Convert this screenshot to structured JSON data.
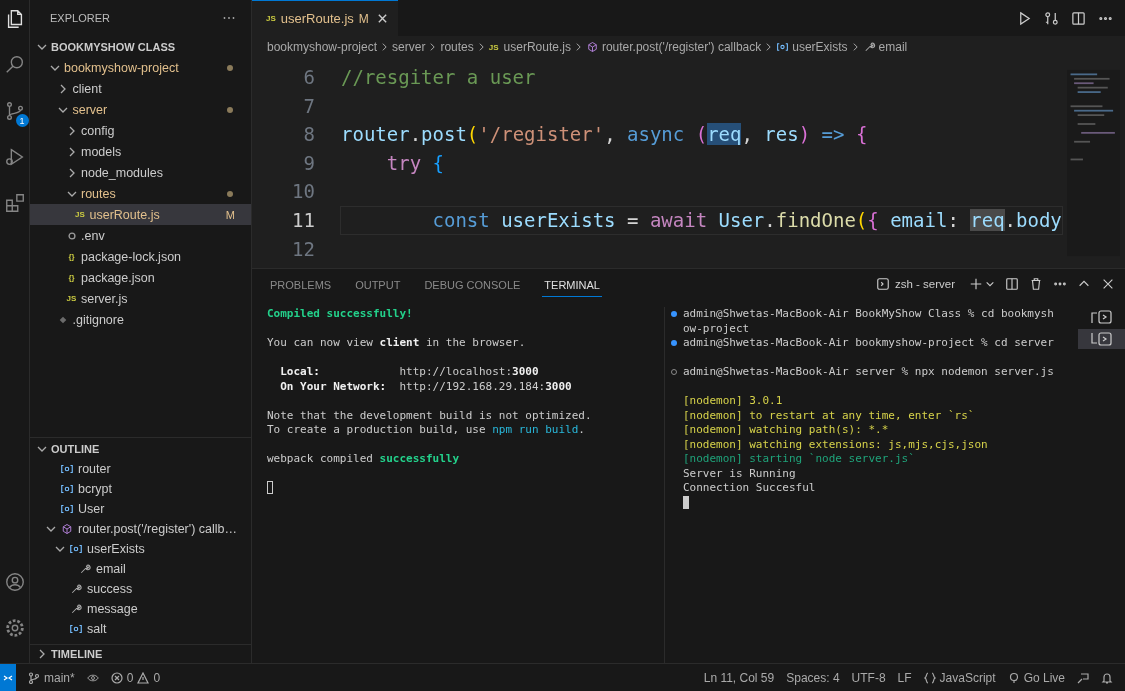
{
  "activity_bar": {
    "items": [
      {
        "kind": "files",
        "selected": true
      },
      {
        "kind": "search",
        "selected": false
      },
      {
        "kind": "source-control",
        "selected": false,
        "badge": "1"
      },
      {
        "kind": "run",
        "selected": false
      },
      {
        "kind": "extensions",
        "selected": false
      }
    ],
    "bottom": [
      {
        "kind": "account"
      },
      {
        "kind": "settings"
      }
    ]
  },
  "explorer": {
    "title": "EXPLORER",
    "workspace": {
      "label": "BOOKMYSHOW CLASS",
      "expanded": true
    },
    "tree": [
      {
        "name": "bookmyshow-project",
        "kind": "folder",
        "expanded": true,
        "modified": true,
        "selected": false,
        "children": [
          {
            "name": "client",
            "kind": "folder",
            "expanded": false,
            "modified": false,
            "selected": false
          },
          {
            "name": "server",
            "kind": "folder",
            "expanded": true,
            "modified": true,
            "selected": false,
            "children": [
              {
                "name": "config",
                "kind": "folder",
                "expanded": false,
                "modified": false,
                "selected": false
              },
              {
                "name": "models",
                "kind": "folder",
                "expanded": false,
                "modified": false,
                "selected": false
              },
              {
                "name": "node_modules",
                "kind": "folder",
                "expanded": false,
                "modified": false,
                "selected": false
              },
              {
                "name": "routes",
                "kind": "folder",
                "expanded": true,
                "modified": true,
                "selected": false,
                "children": [
                  {
                    "name": "userRoute.js",
                    "kind": "js",
                    "icon_text": "JS",
                    "badge": "M",
                    "modified": true,
                    "selected": true
                  }
                ]
              },
              {
                "name": ".env",
                "kind": "env",
                "modified": false,
                "selected": false
              },
              {
                "name": "package-lock.json",
                "kind": "json",
                "icon_text": "{}",
                "modified": false,
                "selected": false
              },
              {
                "name": "package.json",
                "kind": "json",
                "icon_text": "{}",
                "modified": false,
                "selected": false
              },
              {
                "name": "server.js",
                "kind": "js",
                "icon_text": "JS",
                "modified": false,
                "selected": false
              }
            ]
          },
          {
            "name": ".gitignore",
            "kind": "git",
            "modified": false,
            "selected": false
          }
        ]
      }
    ]
  },
  "outline": {
    "label": "OUTLINE",
    "expanded": true,
    "items": [
      {
        "kind": "variable",
        "name": "router",
        "selected": false
      },
      {
        "kind": "variable",
        "name": "bcrypt",
        "selected": false
      },
      {
        "kind": "variable",
        "name": "User",
        "selected": false
      },
      {
        "kind": "function",
        "name": "router.post('/register') callb…",
        "expanded": true,
        "selected": false,
        "children": [
          {
            "kind": "variable",
            "name": "userExists",
            "expanded": true,
            "selected": false,
            "children": [
              {
                "kind": "property",
                "name": "email",
                "selected": false
              }
            ]
          },
          {
            "kind": "property",
            "name": "success",
            "selected": false
          },
          {
            "kind": "property",
            "name": "message",
            "selected": false
          },
          {
            "kind": "variable",
            "name": "salt",
            "selected": false
          }
        ]
      }
    ]
  },
  "timeline": {
    "label": "TIMELINE",
    "expanded": false
  },
  "editor": {
    "tabs": [
      {
        "icon_text": "JS",
        "label": "userRoute.js",
        "badge": "M",
        "selected": true
      }
    ],
    "breadcrumbs": [
      {
        "kind": "folder",
        "label": "bookmyshow-project"
      },
      {
        "kind": "folder",
        "label": "server"
      },
      {
        "kind": "folder",
        "label": "routes"
      },
      {
        "kind": "js",
        "icon_text": "JS",
        "label": "userRoute.js"
      },
      {
        "kind": "function",
        "label": "router.post('/register') callback"
      },
      {
        "kind": "variable",
        "label": "userExists"
      },
      {
        "kind": "property",
        "label": "email"
      }
    ],
    "lines": [
      {
        "number": "6",
        "current": false,
        "tokens": [
          {
            "kind": "comment",
            "text": "//resgiter a user"
          }
        ]
      },
      {
        "number": "7",
        "current": false
      },
      {
        "number": "8",
        "current": false,
        "tokens": [
          {
            "kind": "var",
            "text": "router"
          },
          {
            "kind": "plain",
            "text": "."
          },
          {
            "kind": "var",
            "text": "post"
          },
          {
            "kind": "bracket1",
            "text": "("
          },
          {
            "kind": "string",
            "text": "'/register'"
          },
          {
            "kind": "plain",
            "text": ", "
          },
          {
            "kind": "keyword",
            "text": "async"
          },
          {
            "kind": "bracket2",
            "text": " ("
          },
          {
            "kind": "param",
            "text": "req",
            "selected": true
          },
          {
            "kind": "plain",
            "text": ", "
          },
          {
            "kind": "param",
            "text": "res"
          },
          {
            "kind": "bracket2",
            "text": ")"
          },
          {
            "kind": "keyword",
            "text": " => "
          },
          {
            "kind": "bracket2",
            "text": "{"
          }
        ]
      },
      {
        "number": "9",
        "current": false,
        "tokens": [
          {
            "kind": "control",
            "text": "    try"
          },
          {
            "kind": "bracket3",
            "text": " {"
          }
        ]
      },
      {
        "number": "10",
        "current": false
      },
      {
        "number": "11",
        "current": true,
        "tokens": [
          {
            "kind": "keyword",
            "text": "        const"
          },
          {
            "kind": "var",
            "text": " userExists"
          },
          {
            "kind": "plain",
            "text": " = "
          },
          {
            "kind": "control",
            "text": "await"
          },
          {
            "kind": "var",
            "text": " User"
          },
          {
            "kind": "plain",
            "text": "."
          },
          {
            "kind": "func",
            "text": "findOne"
          },
          {
            "kind": "bracket1",
            "text": "("
          },
          {
            "kind": "bracket2",
            "text": "{"
          },
          {
            "kind": "var",
            "text": " email"
          },
          {
            "kind": "plain",
            "text": ": "
          },
          {
            "kind": "param",
            "text": "req",
            "occurrence": true
          },
          {
            "kind": "plain",
            "text": "."
          },
          {
            "kind": "var",
            "text": "body"
          }
        ]
      },
      {
        "number": "12",
        "current": false
      }
    ]
  },
  "panel": {
    "tabs": [
      {
        "label": "PROBLEMS",
        "selected": false
      },
      {
        "label": "OUTPUT",
        "selected": false
      },
      {
        "label": "DEBUG CONSOLE",
        "selected": false
      },
      {
        "label": "TERMINAL",
        "selected": true
      }
    ],
    "terminal_name": "zsh - server",
    "left_terminal": {
      "cursor": true,
      "blocks": [
        [
          [
            {
              "kind": "success",
              "text": "Compiled successfully!"
            }
          ]
        ],
        [
          [
            {
              "kind": "plain",
              "text": "You can now view "
            },
            {
              "kind": "bold",
              "text": "client"
            },
            {
              "kind": "plain",
              "text": " in the browser."
            }
          ]
        ],
        [
          [
            {
              "kind": "bold",
              "text": "  Local:"
            },
            {
              "kind": "plain",
              "text": "            http://localhost:"
            },
            {
              "kind": "bold",
              "text": "3000"
            }
          ],
          [
            {
              "kind": "bold",
              "text": "  On Your Network:"
            },
            {
              "kind": "plain",
              "text": "  http://192.168.29.184:"
            },
            {
              "kind": "bold",
              "text": "3000"
            }
          ]
        ],
        [
          [
            {
              "kind": "plain",
              "text": "Note that the development build is not optimized."
            }
          ],
          [
            {
              "kind": "plain",
              "text": "To create a production build, use "
            },
            {
              "kind": "link",
              "text": "npm run build"
            },
            {
              "kind": "plain",
              "text": "."
            }
          ]
        ],
        [
          [
            {
              "kind": "plain",
              "text": "webpack compiled "
            },
            {
              "kind": "success",
              "text": "successfully"
            }
          ]
        ]
      ]
    },
    "right_terminal": {
      "cursor": true,
      "commands": [
        {
          "running": false,
          "text": "admin@Shwetas-MacBook-Air BookMyShow Class % cd bookmyshow-project"
        },
        {
          "running": false,
          "text": "admin@Shwetas-MacBook-Air bookmyshow-project % cd server"
        },
        {
          "running": true,
          "text": "admin@Shwetas-MacBook-Air server % npx nodemon server.js"
        }
      ],
      "output": [
        {
          "kind": "info",
          "text": "[nodemon] 3.0.1"
        },
        {
          "kind": "info",
          "text": "[nodemon] to restart at any time, enter `rs`"
        },
        {
          "kind": "info",
          "text": "[nodemon] watching path(s): *.*"
        },
        {
          "kind": "info",
          "text": "[nodemon] watching extensions: js,mjs,cjs,json"
        },
        {
          "kind": "start",
          "text": "[nodemon] starting `node server.js`"
        },
        {
          "kind": "log",
          "text": "Server is Running"
        },
        {
          "kind": "log",
          "text": "Connection Succesful"
        }
      ]
    },
    "terminals": [
      {
        "selected": false
      },
      {
        "selected": true
      }
    ]
  },
  "status_bar": {
    "branch": "main*",
    "errors": "0",
    "warnings": "0",
    "position": "Ln 11, Col 59",
    "indent": "Spaces: 4",
    "encoding": "UTF-8",
    "eol": "LF",
    "language": "JavaScript",
    "live": "Go Live"
  }
}
